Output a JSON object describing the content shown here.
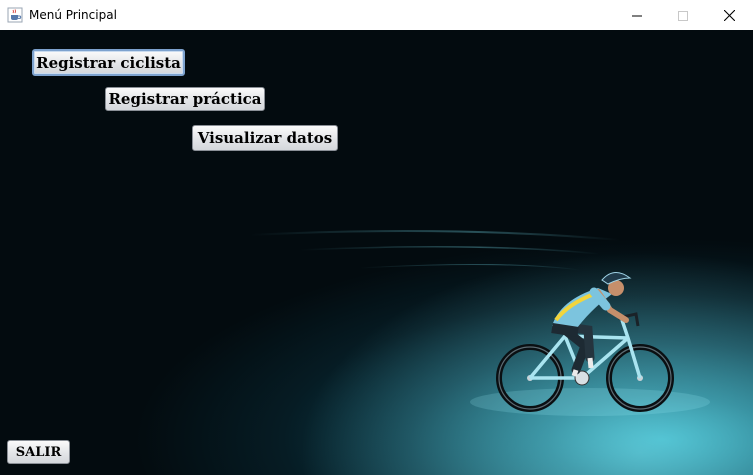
{
  "window": {
    "title": "Menú Principal",
    "app_icon": "java-cup-icon",
    "controls": {
      "minimize_icon": "minimize-icon",
      "maximize_icon": "maximize-icon",
      "close_icon": "close-icon"
    }
  },
  "menu": {
    "register_cyclist_label": "Registrar ciclista",
    "register_practice_label": "Registrar práctica",
    "view_data_label": "Visualizar datos",
    "exit_label": "SALIR"
  },
  "colors": {
    "background_dark": "#030b0f",
    "background_glow": "#2aa6b8",
    "focus_border": "#7da2ce"
  }
}
